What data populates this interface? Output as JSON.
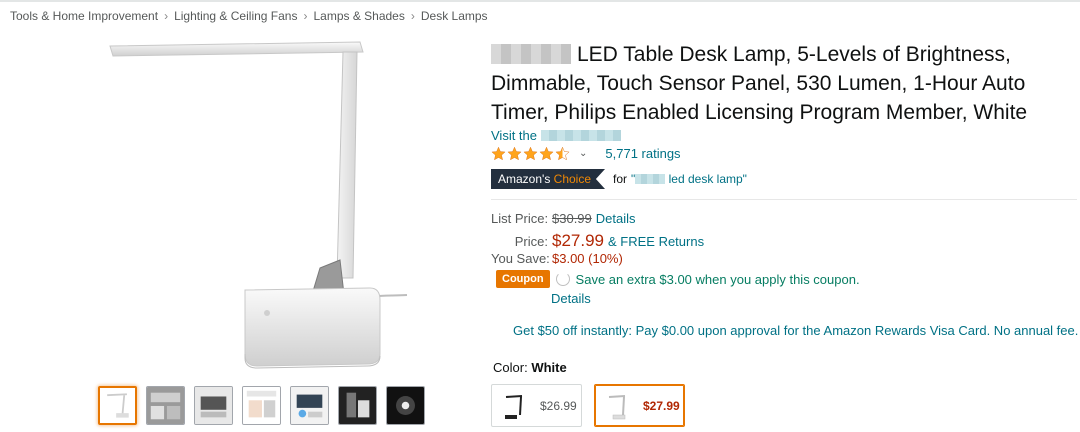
{
  "breadcrumb": [
    "Tools & Home Improvement",
    "Lighting & Ceiling Fans",
    "Lamps & Shades",
    "Desk Lamps"
  ],
  "breadcrumb_separator": "›",
  "product": {
    "title": "LED Table Desk Lamp, 5-Levels of Brightness, Dimmable, Touch Sensor Panel, 530 Lumen, 1-Hour Auto Timer, Philips Enabled Licensing Program Member, White",
    "visit_store": "Visit the",
    "rating_stars": 4.5,
    "rating_chevron": "⌄",
    "ratings_count": "5,771 ratings",
    "choice_badge_prefix": "Amazon's",
    "choice_badge_highlight": "Choice",
    "choice_for": "for",
    "choice_keyword_open": "\"",
    "choice_keyword": "led desk lamp\""
  },
  "pricing": {
    "list_label": "List Price:",
    "list_price": "$30.99",
    "details_label": "Details",
    "price_label": "Price:",
    "price": "$27.99",
    "free_returns": "& FREE Returns",
    "save_label": "You Save:",
    "save_value": "$3.00 (10%)",
    "coupon_tag": "Coupon",
    "coupon_text": "Save an extra $3.00 when you apply this coupon.",
    "coupon_details": "Details"
  },
  "promo": "Get $50 off instantly: Pay $0.00 upon approval for the Amazon Rewards Visa Card. No annual fee.",
  "color": {
    "label": "Color:",
    "value": "White",
    "options": [
      {
        "name": "black-swatch",
        "price": "$26.99",
        "selected": false
      },
      {
        "name": "white-swatch",
        "price": "$27.99",
        "selected": true
      }
    ]
  },
  "colors": {
    "link": "#007185",
    "price": "#b12704",
    "accent": "#e77600",
    "star": "#ffa41c",
    "badge_bg": "#232f3e",
    "coupon_green": "#067d62"
  },
  "thumbnails_count": 7
}
